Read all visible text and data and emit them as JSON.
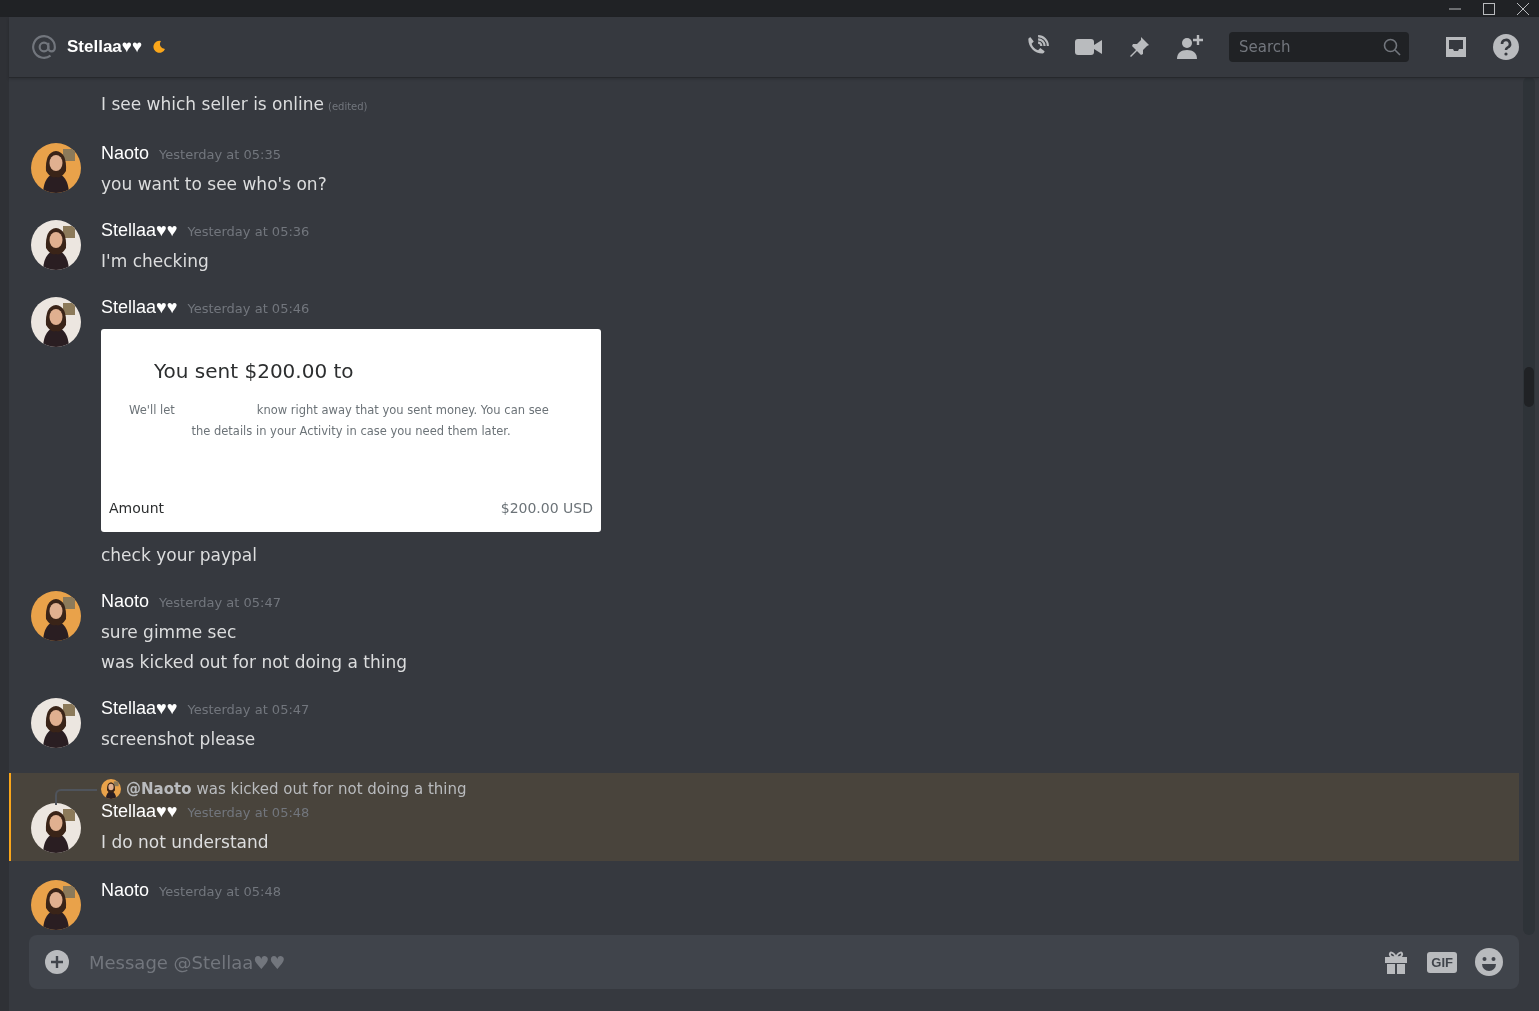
{
  "header": {
    "name": "Stellaa♥♥",
    "status_icon": {
      "kind": "idle"
    },
    "search": {
      "placeholder": "Search"
    }
  },
  "messages": [
    {
      "kind": "continuation",
      "lines": [
        {
          "text": "I see which seller is online",
          "edited": "(edited)"
        }
      ]
    },
    {
      "kind": "group",
      "author": "Naoto",
      "avatar": {
        "kind": "picture",
        "color": "#e9a24a"
      },
      "time": "Yesterday at 05:35",
      "lines": [
        {
          "text": "you want to see who's on?"
        }
      ]
    },
    {
      "kind": "group",
      "author": "Stellaa♥♥",
      "avatar": {
        "kind": "picture",
        "color": "#ece6e0"
      },
      "time": "Yesterday at 05:36",
      "lines": [
        {
          "text": "I'm checking"
        }
      ]
    },
    {
      "kind": "group",
      "author": "Stellaa♥♥",
      "avatar": {
        "kind": "picture",
        "color": "#ece6e0"
      },
      "time": "Yesterday at 05:46",
      "attachment": {
        "title": "You sent $200.00 to",
        "body_start": "We'll let",
        "body_rest": "know right away that you sent money. You can see",
        "body_line2": "the details in your Activity in case you need them later.",
        "amount_label": "Amount",
        "amount_value": "$200.00 USD"
      },
      "lines": [
        {
          "text": "check your paypal"
        }
      ]
    },
    {
      "kind": "group",
      "author": "Naoto",
      "avatar": {
        "kind": "picture",
        "color": "#e9a24a"
      },
      "time": "Yesterday at 05:47",
      "lines": [
        {
          "text": "sure gimme sec"
        },
        {
          "text": "was kicked out for not doing a thing"
        }
      ]
    },
    {
      "kind": "group",
      "author": "Stellaa♥♥",
      "avatar": {
        "kind": "picture",
        "color": "#ece6e0"
      },
      "time": "Yesterday at 05:47",
      "lines": [
        {
          "text": "screenshot please"
        }
      ]
    },
    {
      "kind": "group",
      "author": "Stellaa♥♥",
      "avatar": {
        "kind": "picture",
        "color": "#ece6e0"
      },
      "time": "Yesterday at 05:48",
      "highlighted": true,
      "reply": {
        "mention": "@Naoto",
        "avatar": {
          "kind": "picture",
          "color": "#e9a24a"
        },
        "text": "was kicked out for not doing a thing"
      },
      "lines": [
        {
          "text": "I do not understand"
        }
      ]
    },
    {
      "kind": "group",
      "author": "Naoto",
      "avatar": {
        "kind": "picture",
        "color": "#e9a24a"
      },
      "time": "Yesterday at 05:48"
    }
  ],
  "composer": {
    "placeholder": "Message @Stellaa♥♥",
    "gif": "GIF"
  }
}
